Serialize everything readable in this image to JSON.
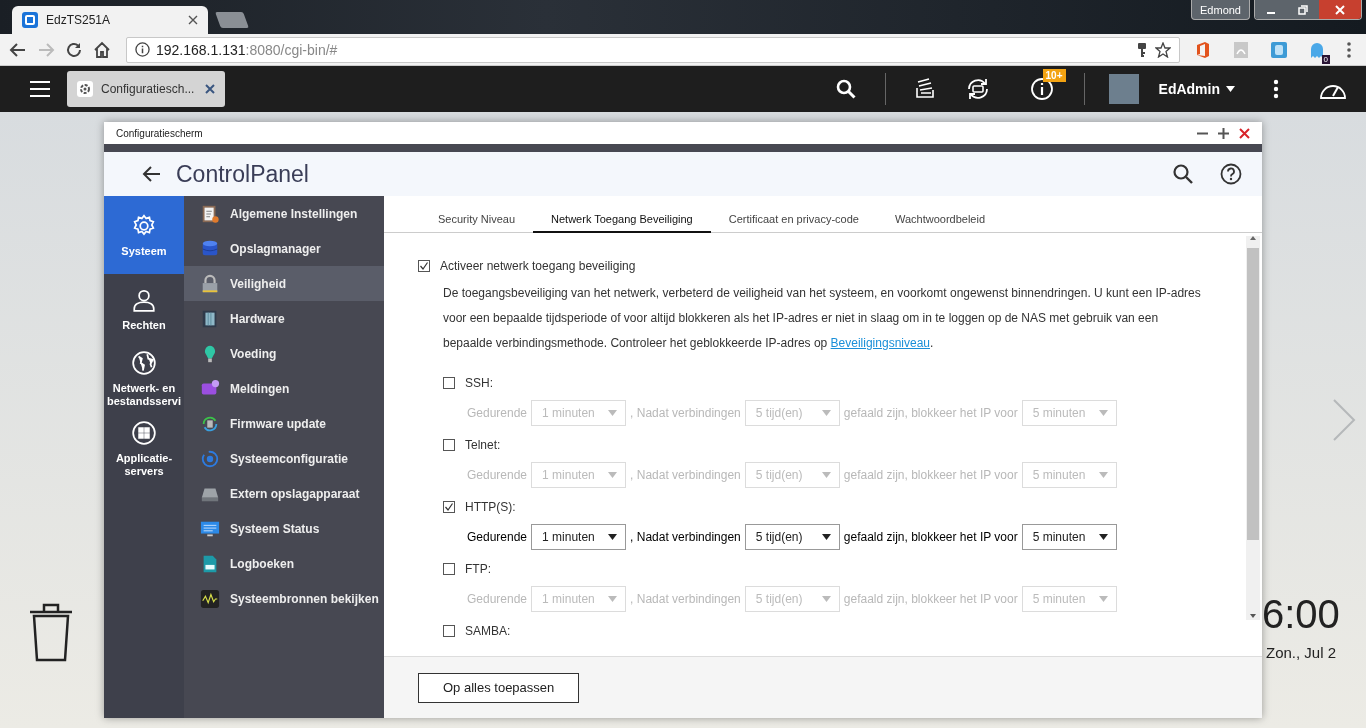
{
  "browser": {
    "tab": {
      "title": "EdzTS251A"
    },
    "profile": "Edmond",
    "url": {
      "host": "192.168.1.131",
      "path": ":8080/cgi-bin/#"
    },
    "extension_badge": "0"
  },
  "top_bar": {
    "app_tab": {
      "title": "Configuratiesch..."
    },
    "notification_badge": "10+",
    "user": "EdAdmin"
  },
  "window": {
    "title": "Configuratiescherm",
    "heading": "**Control**Panel"
  },
  "categories": [
    {
      "kind": "gear",
      "label": "Systeem",
      "selected": true
    },
    {
      "kind": "user",
      "label": "Rechten",
      "selected": false
    },
    {
      "kind": "globe",
      "label": "Netwerk- en bestandsservi",
      "selected": false
    },
    {
      "kind": "grid",
      "label": "Applicatie-servers",
      "selected": false
    }
  ],
  "menu": [
    {
      "kind": "clipboard",
      "label": "Algemene Instellingen",
      "selected": false
    },
    {
      "kind": "database",
      "label": "Opslagmanager",
      "selected": false
    },
    {
      "kind": "lock",
      "label": "Veiligheid",
      "selected": true
    },
    {
      "kind": "chip",
      "label": "Hardware",
      "selected": false
    },
    {
      "kind": "bulb",
      "label": "Voeding",
      "selected": false
    },
    {
      "kind": "message",
      "label": "Meldingen",
      "selected": false
    },
    {
      "kind": "update",
      "label": "Firmware update",
      "selected": false
    },
    {
      "kind": "cog",
      "label": "Systeemconfiguratie",
      "selected": false
    },
    {
      "kind": "drive",
      "label": "Extern opslagapparaat",
      "selected": false
    },
    {
      "kind": "monitor",
      "label": "Systeem Status",
      "selected": false
    },
    {
      "kind": "log",
      "label": "Logboeken",
      "selected": false
    },
    {
      "kind": "pulse",
      "label": "Systeembronnen bekijken",
      "selected": false
    }
  ],
  "tabs": [
    {
      "label": "Security Niveau",
      "selected": false
    },
    {
      "label": "Netwerk Toegang Beveiliging",
      "selected": true
    },
    {
      "label": "Certificaat en privacy-code",
      "selected": false
    },
    {
      "label": "Wachtwoordbeleid",
      "selected": false
    }
  ],
  "enable": {
    "label": "Activeer netwerk toegang beveiliging",
    "checked": true
  },
  "description": {
    "text": "De toegangsbeveiliging van het netwerk, verbeterd de veiligheid van het systeem, en voorkomt ongewenst binnendringen. U kunt een IP-adres voor een bepaalde tijdsperiode of voor altijd blokkeren als het IP-adres er niet in slaag om in te loggen op de NAS met gebruik van een bepaalde verbindingsmethode. Controleer het geblokkeerde IP-adres op ",
    "link": "Beveiligingsniveau",
    "after": "."
  },
  "protocols": [
    {
      "label": "SSH:",
      "checked": false,
      "settings": {
        "period_label": "Gedurende",
        "period": "1 minuten",
        "attempts_label": ", Nadat verbindingen",
        "attempts": "5 tijd(en)",
        "block_label": "gefaald zijn, blokkeer het IP voor",
        "block_time": "5 minuten"
      }
    },
    {
      "label": "Telnet:",
      "checked": false,
      "settings": {
        "period_label": "Gedurende",
        "period": "1 minuten",
        "attempts_label": ", Nadat verbindingen",
        "attempts": "5 tijd(en)",
        "block_label": "gefaald zijn, blokkeer het IP voor",
        "block_time": "5 minuten"
      }
    },
    {
      "label": "HTTP(S):",
      "checked": true,
      "settings": {
        "period_label": "Gedurende",
        "period": "1 minuten",
        "attempts_label": ", Nadat verbindingen",
        "attempts": "5 tijd(en)",
        "block_label": "gefaald zijn, blokkeer het IP voor",
        "block_time": "5 minuten"
      }
    },
    {
      "label": "FTP:",
      "checked": false,
      "settings": {
        "period_label": "Gedurende",
        "period": "1 minuten",
        "attempts_label": ", Nadat verbindingen",
        "attempts": "5 tijd(en)",
        "block_label": "gefaald zijn, blokkeer het IP voor",
        "block_time": "5 minuten"
      }
    },
    {
      "label": "SAMBA:",
      "checked": false
    }
  ],
  "apply_button": "Op alles toepassen",
  "desktop": {
    "clock": "6:00",
    "date": "Zon., Jul 2"
  }
}
